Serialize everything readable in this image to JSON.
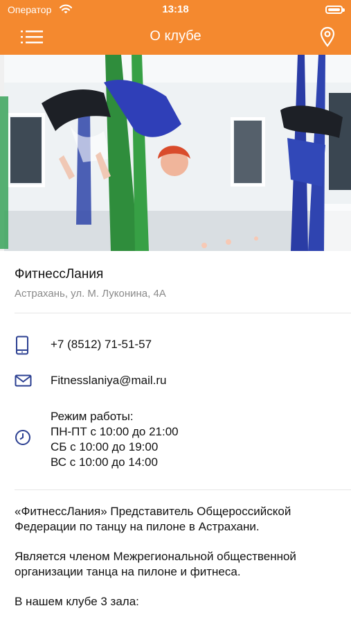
{
  "status_bar": {
    "carrier": "Оператор",
    "time": "13:18"
  },
  "nav": {
    "title": "О клубе",
    "menu_icon": "hamburger-menu-icon",
    "location_icon": "map-pin-icon"
  },
  "colors": {
    "accent": "#f4892f",
    "icon_blue": "#2b3f91"
  },
  "club": {
    "name": "ФитнессЛания",
    "address": "Астрахань, ул. М. Луконина, 4А",
    "phone": "+7 (8512) 71-51-57",
    "email": "Fitnesslaniya@mail.ru",
    "hours": {
      "title": "Режим работы:",
      "lines": [
        "ПН-ПТ с 10:00 до 21:00",
        "СБ с 10:00 до 19:00",
        "ВС с 10:00 до 14:00"
      ]
    }
  },
  "about": {
    "paragraphs": [
      "«ФитнессЛания» Представитель Общероссийской Федерации по танцу на пилоне в Астрахани.",
      "Является членом Межрегиональной общественной организации танца на пилоне и фитнеса.",
      "В нашем клубе 3 зала:"
    ]
  }
}
